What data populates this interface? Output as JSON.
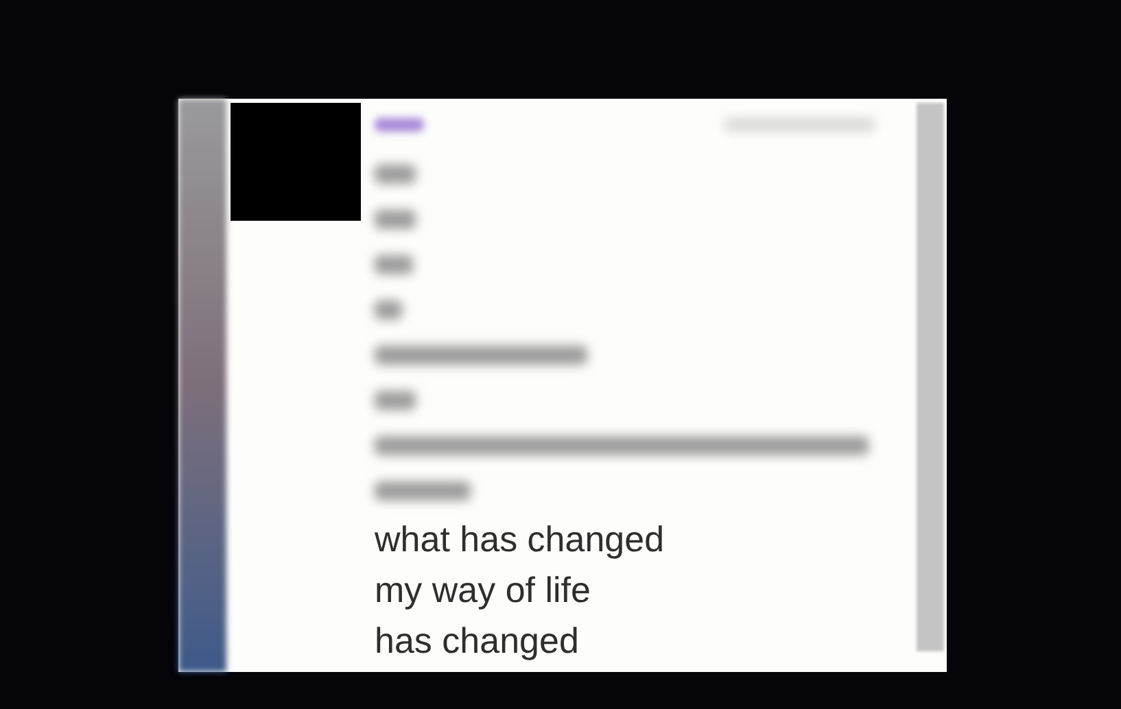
{
  "message": {
    "lines": [
      "what has changed",
      "my way of life",
      "has changed"
    ]
  }
}
